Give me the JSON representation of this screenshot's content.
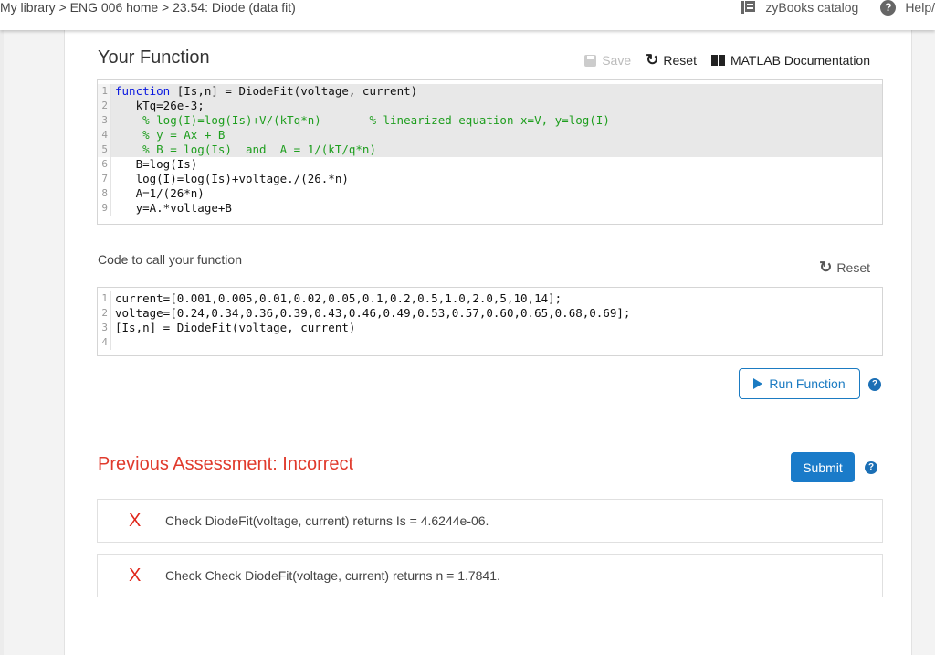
{
  "topbar": {
    "breadcrumb": [
      "My library",
      "ENG 006 home",
      "23.54: Diode (data fit)"
    ],
    "separator": " > ",
    "catalog_label": "zyBooks catalog",
    "help_label": "Help/"
  },
  "function_section": {
    "title": "Your Function",
    "save_label": "Save",
    "reset_label": "Reset",
    "docs_label": "MATLAB Documentation",
    "code_lines": [
      {
        "n": "1",
        "locked": true,
        "parts": [
          {
            "t": "kw",
            "s": "function"
          },
          {
            "t": "",
            "s": " [Is,n] = DiodeFit(voltage, current)"
          }
        ]
      },
      {
        "n": "2",
        "locked": true,
        "parts": [
          {
            "t": "",
            "s": "   kTq=26e-3;"
          }
        ]
      },
      {
        "n": "3",
        "locked": true,
        "parts": [
          {
            "t": "cm",
            "s": "    % log(I)=log(Is)+V/(kTq*n)       % linearized equation x=V, y=log(I)"
          }
        ]
      },
      {
        "n": "4",
        "locked": true,
        "parts": [
          {
            "t": "cm",
            "s": "    % y = Ax + B"
          }
        ]
      },
      {
        "n": "5",
        "locked": true,
        "parts": [
          {
            "t": "cm",
            "s": "    % B = log(Is)  and  A = 1/(kT/q*n)"
          }
        ]
      },
      {
        "n": "6",
        "locked": false,
        "parts": [
          {
            "t": "",
            "s": "   B=log(Is)"
          }
        ]
      },
      {
        "n": "7",
        "locked": false,
        "parts": [
          {
            "t": "",
            "s": "   log(I)=log(Is)+voltage./(26.*n)"
          }
        ]
      },
      {
        "n": "8",
        "locked": false,
        "parts": [
          {
            "t": "",
            "s": "   A=1/(26*n)"
          }
        ]
      },
      {
        "n": "9",
        "locked": false,
        "parts": [
          {
            "t": "",
            "s": "   y=A.*voltage+B"
          }
        ]
      }
    ]
  },
  "call_section": {
    "label": "Code to call your function",
    "reset_label": "Reset",
    "code_lines": [
      {
        "n": "1",
        "text": "current=[0.001,0.005,0.01,0.02,0.05,0.1,0.2,0.5,1.0,2.0,5,10,14];"
      },
      {
        "n": "2",
        "text": "voltage=[0.24,0.34,0.36,0.39,0.43,0.46,0.49,0.53,0.57,0.60,0.65,0.68,0.69];"
      },
      {
        "n": "3",
        "text": "[Is,n] = DiodeFit(voltage, current)"
      },
      {
        "n": "4",
        "text": ""
      }
    ],
    "run_label": "Run Function"
  },
  "assessment": {
    "title": "Previous Assessment: Incorrect",
    "submit_label": "Submit",
    "results": [
      {
        "status": "X",
        "text": "Check DiodeFit(voltage, current) returns Is = 4.6244e-06."
      },
      {
        "status": "X",
        "text": "Check Check DiodeFit(voltage, current) returns n = 1.7841."
      }
    ]
  },
  "colors": {
    "accent": "#1b7bc2",
    "error": "#e03a2c",
    "comment": "#1e9e1e",
    "keyword": "#0a19e0"
  }
}
